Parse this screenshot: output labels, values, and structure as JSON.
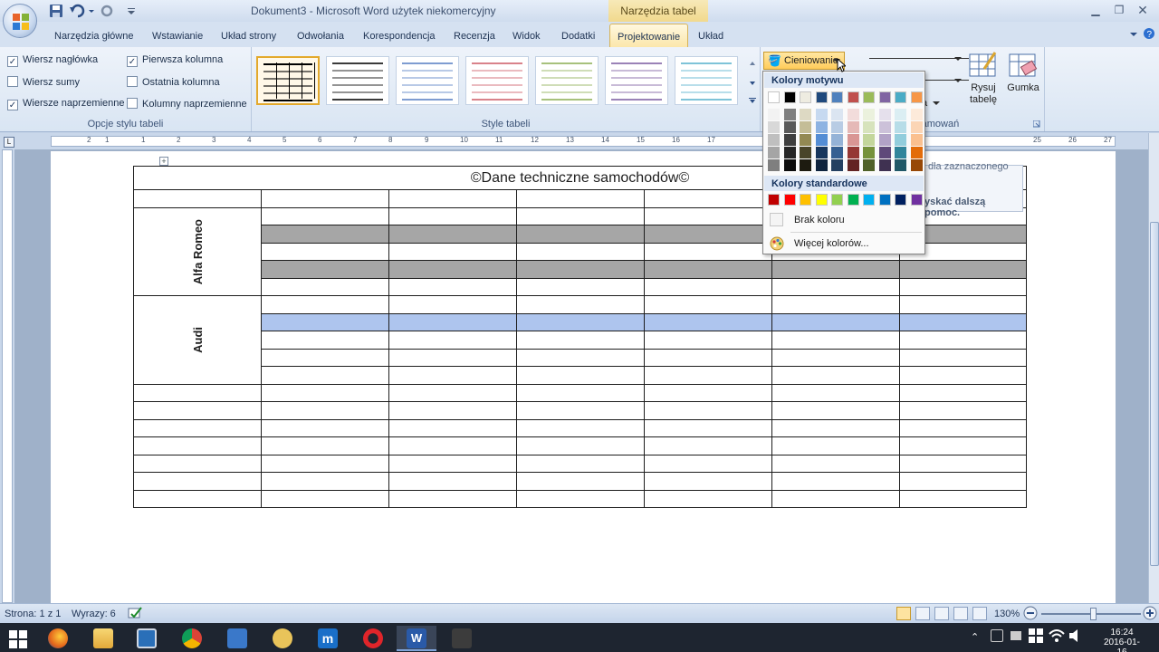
{
  "window": {
    "title": "Dokument3 - Microsoft Word użytek niekomercyjny",
    "context_tab": "Narzędzia tabel"
  },
  "tabs": [
    "Narzędzia główne",
    "Wstawianie",
    "Układ strony",
    "Odwołania",
    "Korespondencja",
    "Recenzja",
    "Widok",
    "Dodatki",
    "Projektowanie",
    "Układ"
  ],
  "active_tab": "Projektowanie",
  "style_options": {
    "group_label": "Opcje stylu tabeli",
    "checks": [
      {
        "label": "Wiersz nagłówka",
        "checked": true
      },
      {
        "label": "Wiersz sumy",
        "checked": false
      },
      {
        "label": "Wiersze naprzemienne",
        "checked": true
      },
      {
        "label": "Pierwsza kolumna",
        "checked": true
      },
      {
        "label": "Ostatnia kolumna",
        "checked": false
      },
      {
        "label": "Kolumny naprzemienne",
        "checked": false
      }
    ]
  },
  "table_styles": {
    "group_label": "Style tabeli",
    "line_colors": [
      "#000000",
      "#3a3a3a",
      "#7e9cd1",
      "#d9828a",
      "#a7c17c",
      "#9a82b7",
      "#7ec3d8"
    ]
  },
  "borders_group": {
    "shading_label": "Cieniowanie",
    "group_label_partial": "nie obramowań",
    "partial_label": "a",
    "draw_table": "Rysuj tabelę",
    "eraser": "Gumka"
  },
  "shading_menu": {
    "theme_header": "Kolory motywu",
    "standard_header": "Kolory standardowe",
    "theme_top": [
      "#ffffff",
      "#000000",
      "#eeece1",
      "#1f497d",
      "#4f81bd",
      "#c0504d",
      "#9bbb59",
      "#8064a2",
      "#4bacc6",
      "#f79646"
    ],
    "theme_shades": [
      [
        "#f2f2f2",
        "#d8d8d8",
        "#bfbfbf",
        "#a5a5a5",
        "#7f7f7f"
      ],
      [
        "#7f7f7f",
        "#595959",
        "#3f3f3f",
        "#262626",
        "#0c0c0c"
      ],
      [
        "#ddd9c3",
        "#c4bd97",
        "#938953",
        "#494429",
        "#1d1b10"
      ],
      [
        "#c6d9f0",
        "#8db3e2",
        "#548dd4",
        "#17365d",
        "#0f243e"
      ],
      [
        "#dbe5f1",
        "#b8cce4",
        "#95b3d7",
        "#366092",
        "#244061"
      ],
      [
        "#f2dcdb",
        "#e5b9b7",
        "#d99694",
        "#953734",
        "#632423"
      ],
      [
        "#ebf1dd",
        "#d7e3bc",
        "#c3d69b",
        "#76923c",
        "#4f6128"
      ],
      [
        "#e5e0ec",
        "#ccc1d9",
        "#b2a2c7",
        "#5f497a",
        "#3f3151"
      ],
      [
        "#dbeef3",
        "#b7dde8",
        "#92cddc",
        "#31859b",
        "#205867"
      ],
      [
        "#fdeada",
        "#fbd5b5",
        "#fac08f",
        "#e36c09",
        "#974806"
      ]
    ],
    "standard": [
      "#c00000",
      "#ff0000",
      "#ffc000",
      "#ffff00",
      "#92d050",
      "#00b050",
      "#00b0f0",
      "#0070c0",
      "#002060",
      "#7030a0"
    ],
    "no_color": "Brak koloru",
    "more_colors": "Więcej kolorów..."
  },
  "tooltip": {
    "line1": "dla zaznaczonego",
    "line2": "yskać dalszą pomoc."
  },
  "document": {
    "table_title": "©Dane techniczne samochodów©",
    "brands": [
      "Alfa Romeo",
      "Audi"
    ]
  },
  "ruler_numbers": [
    "2",
    "1",
    "1",
    "2",
    "3",
    "4",
    "5",
    "6",
    "7",
    "8",
    "9",
    "10",
    "11",
    "12",
    "13",
    "14",
    "15",
    "16",
    "17",
    "25",
    "26",
    "27"
  ],
  "status": {
    "page": "Strona: 1 z 1",
    "words": "Wyrazy: 6",
    "zoom": "130%"
  },
  "clock": {
    "time": "16:24",
    "date": "2016-01-16"
  }
}
